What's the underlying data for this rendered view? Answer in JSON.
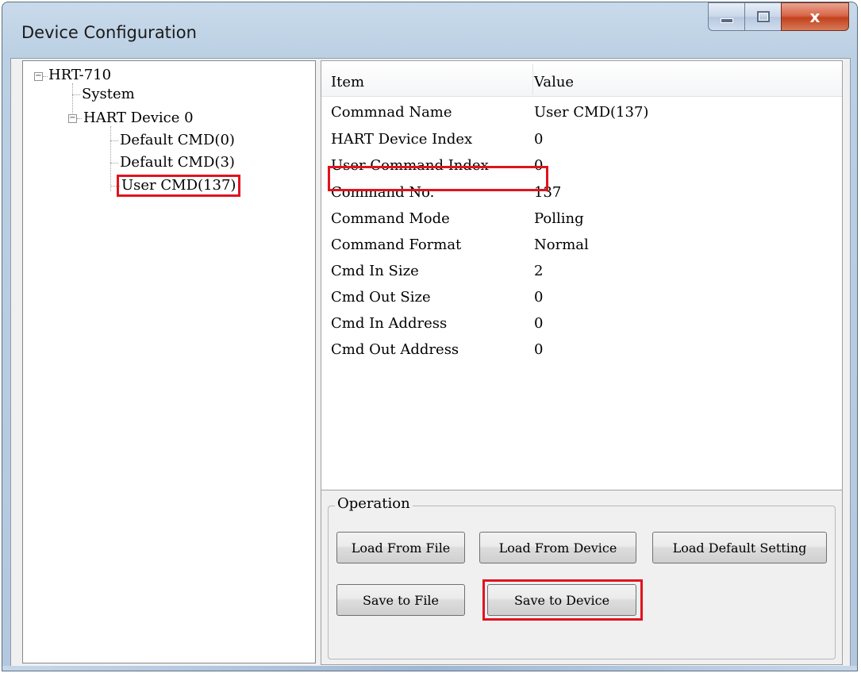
{
  "window": {
    "title": "Device Configuration",
    "close_glyph": "x"
  },
  "tree": {
    "root": "HRT-710",
    "system": "System",
    "device": "HART Device 0",
    "children": [
      "Default CMD(0)",
      "Default CMD(3)",
      "User CMD(137)"
    ],
    "selected": "User CMD(137)"
  },
  "list": {
    "headers": {
      "item": "Item",
      "value": "Value"
    },
    "rows": [
      {
        "item": "Commnad Name",
        "value": "User CMD(137)"
      },
      {
        "item": "HART Device Index",
        "value": "0"
      },
      {
        "item": "User Command Index",
        "value": "0"
      },
      {
        "item": "Command No.",
        "value": "137"
      },
      {
        "item": "Command Mode",
        "value": "Polling"
      },
      {
        "item": "Command Format",
        "value": "Normal"
      },
      {
        "item": "Cmd In Size",
        "value": "2"
      },
      {
        "item": "Cmd Out Size",
        "value": "0"
      },
      {
        "item": "Cmd In Address",
        "value": "0"
      },
      {
        "item": "Cmd Out Address",
        "value": "0"
      }
    ]
  },
  "operation": {
    "title": "Operation",
    "load_from_file": "Load From File",
    "load_from_device": "Load From Device",
    "load_default": "Load Default Setting",
    "save_to_file": "Save to File",
    "save_to_device": "Save to Device"
  },
  "colors": {
    "highlight": "#e0141e",
    "close_button": "#c2421f"
  }
}
